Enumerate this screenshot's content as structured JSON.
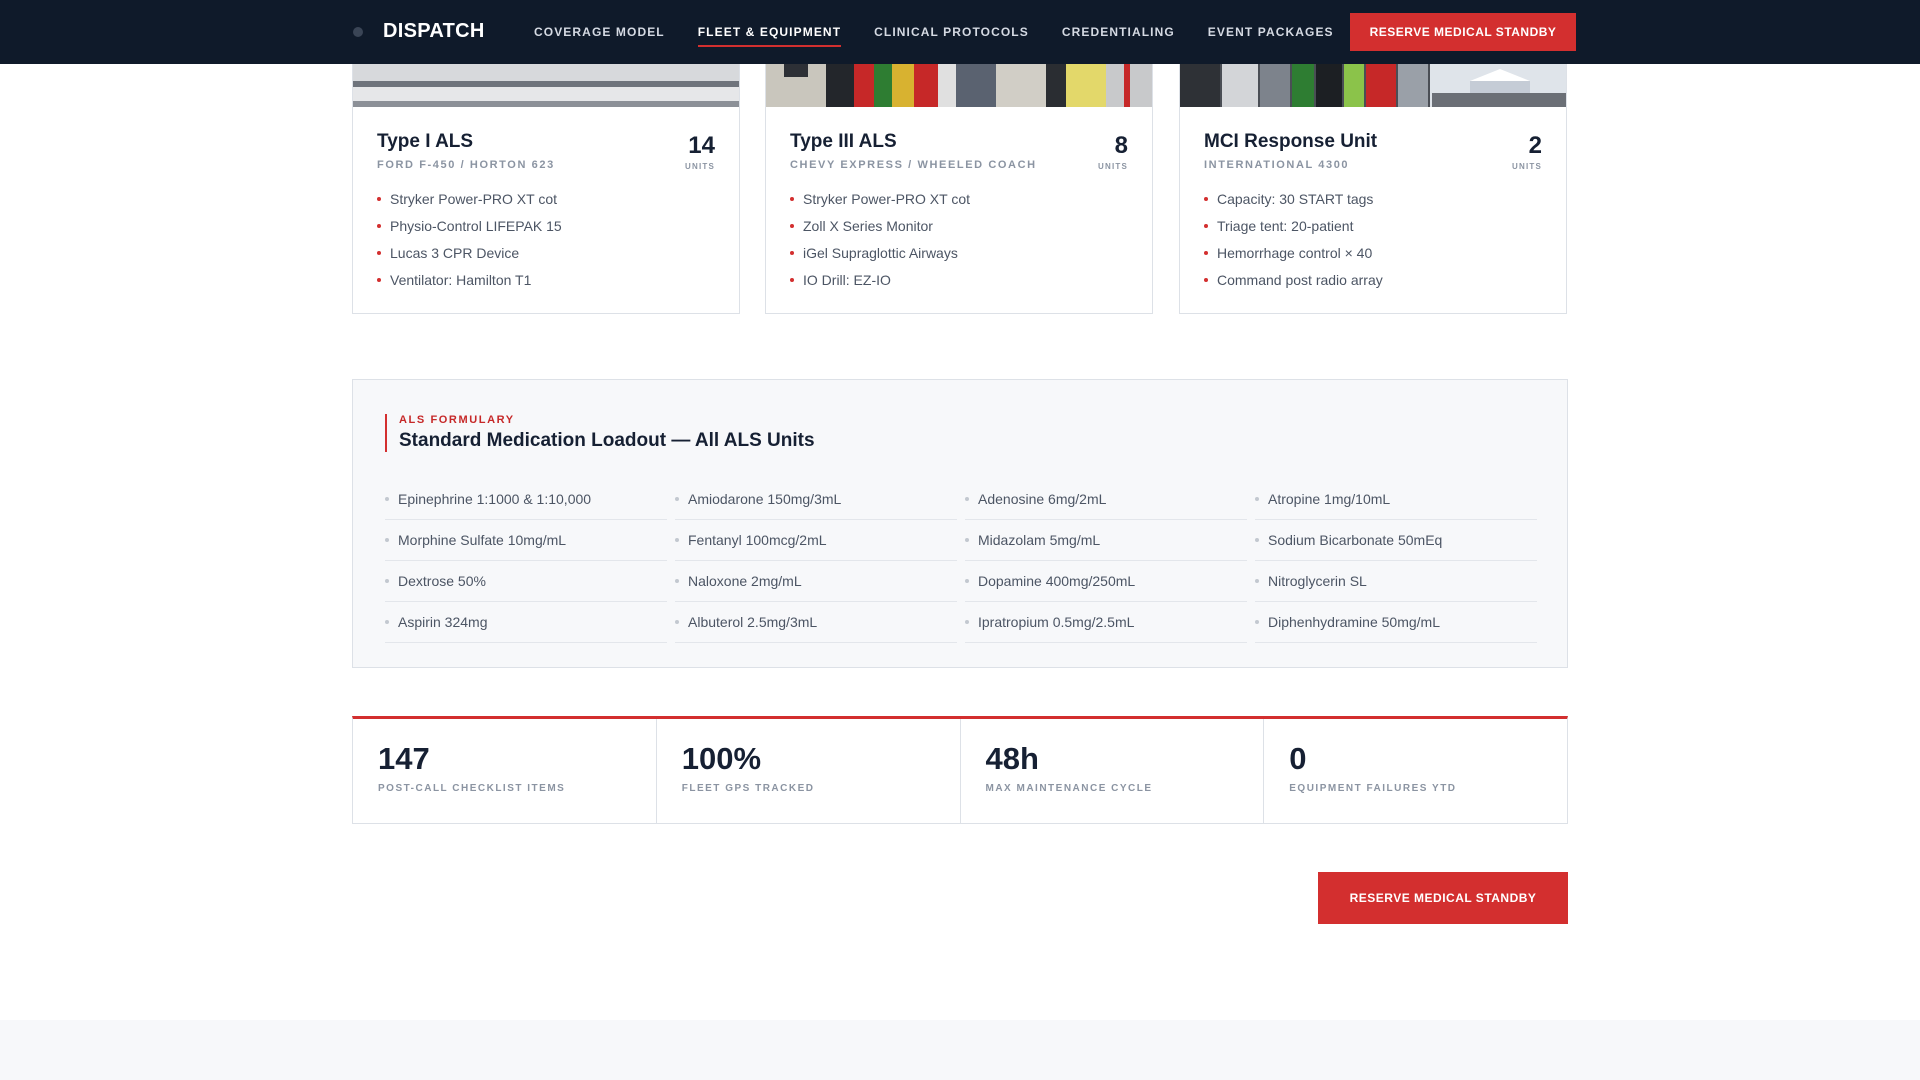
{
  "nav": {
    "brand": "DISPATCH",
    "links": [
      "COVERAGE MODEL",
      "FLEET & EQUIPMENT",
      "CLINICAL PROTOCOLS",
      "CREDENTIALING",
      "EVENT PACKAGES"
    ],
    "active_link": "FLEET & EQUIPMENT",
    "cta": "RESERVE MEDICAL STANDBY"
  },
  "fleet": [
    {
      "title": "Type I ALS",
      "subtitle": "FORD F-450 / HORTON 623",
      "count": "14",
      "unit_label": "UNITS",
      "specs": [
        "Stryker Power-PRO XT cot",
        "Physio-Control LIFEPAK 15",
        "Lucas 3 CPR Device",
        "Ventilator: Hamilton T1"
      ]
    },
    {
      "title": "Type III ALS",
      "subtitle": "CHEVY EXPRESS / WHEELED COACH",
      "count": "8",
      "unit_label": "UNITS",
      "specs": [
        "Stryker Power-PRO XT cot",
        "Zoll X Series Monitor",
        "iGel Supraglottic Airways",
        "IO Drill: EZ-IO"
      ]
    },
    {
      "title": "MCI Response Unit",
      "subtitle": "INTERNATIONAL 4300",
      "count": "2",
      "unit_label": "UNITS",
      "specs": [
        "Capacity: 30 START tags",
        "Triage tent: 20-patient",
        "Hemorrhage control × 40",
        "Command post radio array"
      ]
    }
  ],
  "formulary": {
    "eyebrow": "ALS FORMULARY",
    "title": "Standard Medication Loadout — All ALS Units",
    "medications": [
      "Epinephrine 1:1000 & 1:10,000",
      "Amiodarone 150mg/3mL",
      "Adenosine 6mg/2mL",
      "Atropine 1mg/10mL",
      "Morphine Sulfate 10mg/mL",
      "Fentanyl 100mcg/2mL",
      "Midazolam 5mg/mL",
      "Sodium Bicarbonate 50mEq",
      "Dextrose 50%",
      "Naloxone 2mg/mL",
      "Dopamine 400mg/250mL",
      "Nitroglycerin SL",
      "Aspirin 324mg",
      "Albuterol 2.5mg/3mL",
      "Ipratropium 0.5mg/2.5mL",
      "Diphenhydramine 50mg/mL"
    ]
  },
  "stats": [
    {
      "value": "147",
      "label": "POST-CALL CHECKLIST ITEMS"
    },
    {
      "value": "100%",
      "label": "FLEET GPS TRACKED"
    },
    {
      "value": "48h",
      "label": "MAX MAINTENANCE CYCLE"
    },
    {
      "value": "0",
      "label": "EQUIPMENT FAILURES YTD"
    }
  ],
  "cta_bottom": "RESERVE MEDICAL STANDBY",
  "colors": {
    "nav_bg": "#0f1a2a",
    "accent": "#d32f2f",
    "text_dark": "#162033",
    "text_muted": "#8b94a2",
    "panel_bg": "#f7f8fa"
  }
}
